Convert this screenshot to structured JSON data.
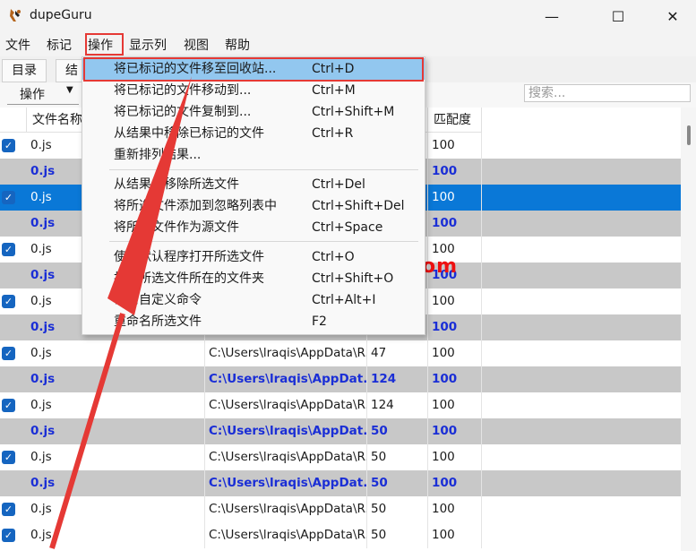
{
  "window": {
    "title": "dupeGuru",
    "controls": [
      "—",
      "☐",
      "✕"
    ]
  },
  "menubar": [
    "文件",
    "标记",
    "操作",
    "显示列",
    "视图",
    "帮助"
  ],
  "tabs": [
    "目录",
    "结"
  ],
  "toolbar": {
    "action_label": "操作",
    "search_placeholder": "搜索..."
  },
  "columns": [
    "文件名称",
    "",
    "",
    "匹配度"
  ],
  "rows": [
    {
      "type": "normal",
      "checked": true,
      "name": "0.js",
      "folder": "",
      "size": "",
      "match": "100"
    },
    {
      "type": "ref",
      "checked": false,
      "name": "0.js",
      "folder": "",
      "size": "",
      "match": "100"
    },
    {
      "type": "selected",
      "checked": true,
      "name": "0.js",
      "folder": "",
      "size": "",
      "match": "100"
    },
    {
      "type": "ref",
      "checked": false,
      "name": "0.js",
      "folder": "",
      "size": "",
      "match": "100"
    },
    {
      "type": "normal",
      "checked": true,
      "name": "0.js",
      "folder": "",
      "size": "",
      "match": "100"
    },
    {
      "type": "ref",
      "checked": false,
      "name": "0.js",
      "folder": "",
      "size": "",
      "match": "100"
    },
    {
      "type": "normal",
      "checked": true,
      "name": "0.js",
      "folder": "",
      "size": "",
      "match": "100"
    },
    {
      "type": "ref",
      "checked": false,
      "name": "0.js",
      "folder": "",
      "size": "",
      "match": "100"
    },
    {
      "type": "normal",
      "checked": true,
      "name": "0.js",
      "folder": "C:\\Users\\lraqis\\AppData\\R...",
      "size": "47",
      "match": "100"
    },
    {
      "type": "ref",
      "checked": false,
      "name": "0.js",
      "folder": "C:\\Users\\lraqis\\AppDat...",
      "size": "124",
      "match": "100"
    },
    {
      "type": "normal",
      "checked": true,
      "name": "0.js",
      "folder": "C:\\Users\\lraqis\\AppData\\R...",
      "size": "124",
      "match": "100"
    },
    {
      "type": "ref",
      "checked": false,
      "name": "0.js",
      "folder": "C:\\Users\\lraqis\\AppDat...",
      "size": "50",
      "match": "100"
    },
    {
      "type": "normal",
      "checked": true,
      "name": "0.js",
      "folder": "C:\\Users\\lraqis\\AppData\\R...",
      "size": "50",
      "match": "100"
    },
    {
      "type": "ref",
      "checked": false,
      "name": "0.js",
      "folder": "C:\\Users\\lraqis\\AppDat...",
      "size": "50",
      "match": "100"
    },
    {
      "type": "normal",
      "checked": true,
      "name": "0.js",
      "folder": "C:\\Users\\lraqis\\AppData\\R...",
      "size": "50",
      "match": "100"
    },
    {
      "type": "normal",
      "checked": true,
      "name": "0.js",
      "folder": "C:\\Users\\lraqis\\AppData\\R...",
      "size": "50",
      "match": "100"
    }
  ],
  "dropdown": [
    {
      "label": "将已标记的文件移至回收站...",
      "shortcut": "Ctrl+D",
      "highlighted": true
    },
    {
      "label": "将已标记的文件移动到...",
      "shortcut": "Ctrl+M"
    },
    {
      "label": "将已标记的文件复制到...",
      "shortcut": "Ctrl+Shift+M"
    },
    {
      "label": "从结果中移除已标记的文件",
      "shortcut": "Ctrl+R"
    },
    {
      "label": "重新排列结果...",
      "shortcut": ""
    },
    {
      "label": "从结果中移除所选文件",
      "shortcut": "Ctrl+Del"
    },
    {
      "label": "将所选文件添加到忽略列表中",
      "shortcut": "Ctrl+Shift+Del"
    },
    {
      "label": "将所选文件作为源文件",
      "shortcut": "Ctrl+Space"
    },
    {
      "label": "使用默认程序打开所选文件",
      "shortcut": "Ctrl+O"
    },
    {
      "label": "打开所选文件所在的文件夹",
      "shortcut": "Ctrl+Shift+O"
    },
    {
      "label": "调用自定义命令",
      "shortcut": "Ctrl+Alt+I"
    },
    {
      "label": "重命名所选文件",
      "shortcut": "F2"
    }
  ],
  "watermark": "www.dgrai.com",
  "colors": {
    "ref_text": "#1a2ed6",
    "selection": "#0a78d7",
    "highlight": "#92c7ef",
    "annotation": "#e53935"
  }
}
